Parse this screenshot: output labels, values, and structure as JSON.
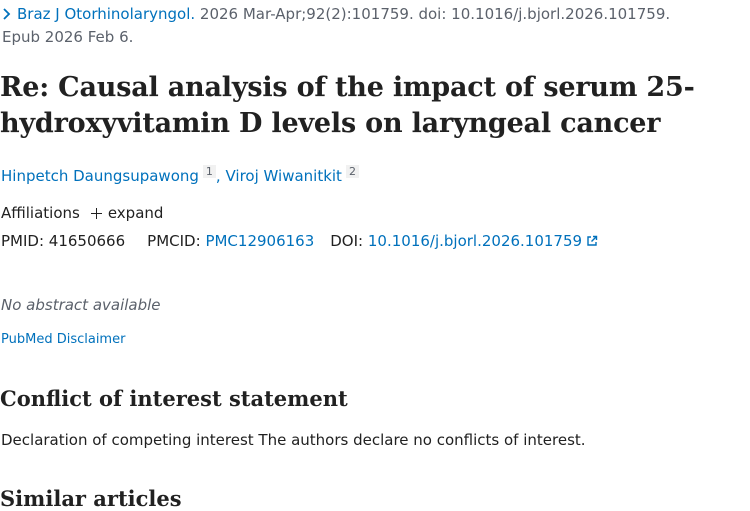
{
  "citation": {
    "journal": "Braz J Otorhinolaryngol.",
    "details": " 2026 Mar-Apr;92(2):101759. doi: 10.1016/j.bjorl.2026.101759.",
    "epub": "Epub 2026 Feb 6."
  },
  "title": "Re: Causal analysis of the impact of serum 25-hydroxyvitamin D levels on laryngeal cancer",
  "authors": [
    {
      "name": "Hinpetch Daungsupawong",
      "sup": "1"
    },
    {
      "name": "Viroj Wiwanitkit",
      "sup": "2"
    }
  ],
  "author_separator": ",",
  "affiliations": {
    "label": "Affiliations",
    "expand": "expand"
  },
  "ids": {
    "pmid_label": "PMID:",
    "pmid": "41650666",
    "pmcid_label": "PMCID:",
    "pmcid": "PMC12906163",
    "doi_label": "DOI:",
    "doi": "10.1016/j.bjorl.2026.101759"
  },
  "abstract_note": "No abstract available",
  "disclaimer": "PubMed Disclaimer",
  "conflict": {
    "heading": "Conflict of interest statement",
    "text": "Declaration of competing interest The authors declare no conflicts of interest."
  },
  "similar_heading": "Similar articles",
  "colors": {
    "link": "#0071bc",
    "text": "#212121",
    "muted": "#5b616b"
  },
  "icons": [
    "chevron-right-icon",
    "plus-icon",
    "external-link-icon"
  ]
}
